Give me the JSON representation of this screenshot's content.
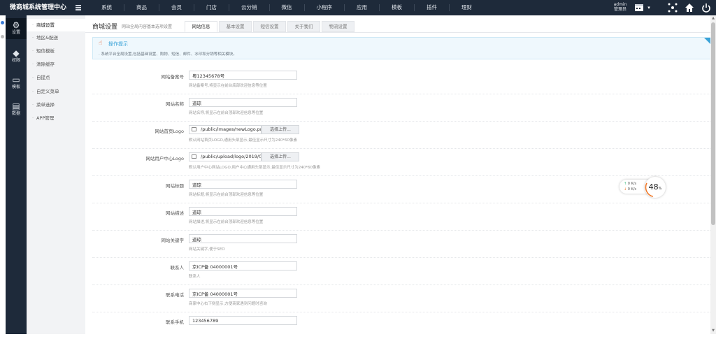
{
  "brand": {
    "title": "微商城系统管理中心"
  },
  "topnav": [
    "系统",
    "商品",
    "会员",
    "门店",
    "云分销",
    "微信",
    "小程序",
    "应用",
    "模板",
    "插件",
    "理财"
  ],
  "admin": {
    "name": "admin",
    "role": "管理员"
  },
  "sidebar": [
    {
      "label": "设置",
      "icon": "gear-icon"
    },
    {
      "label": "权限",
      "icon": "diamond-icon"
    },
    {
      "label": "模板",
      "icon": "monitor-icon"
    },
    {
      "label": "数据",
      "icon": "document-icon"
    }
  ],
  "subnav": [
    "商城设置",
    "地区&配送",
    "短信模板",
    "清除缓存",
    "自提点",
    "自定义菜单",
    "菜单选择",
    "APP管理"
  ],
  "page": {
    "title": "商城设置",
    "subtitle": "网站全局内容基本选项设置"
  },
  "tabs": [
    "网站信息",
    "基本设置",
    "短信设置",
    "关于我们",
    "物流设置"
  ],
  "tips": {
    "title": "操作提示",
    "text": "系统平台全局设置,包括基础设置、购物、短信、邮件、水印和分销等相关模块。"
  },
  "form": [
    {
      "label": "网站备案号",
      "value": "粤12345678号",
      "hint": "网站备案号,将显示在前台底部欢迎信息等位置"
    },
    {
      "label": "网站名称",
      "value": "道琼",
      "hint": "网站名称,将显示在前台顶部欢迎信息等位置"
    },
    {
      "label": "网站首页Logo",
      "value": "/public/images/newLogo.png",
      "button": "选择上传...",
      "hint": "默认网站首页LOGO,通用头部显示,最佳显示尺寸为240*60像素"
    },
    {
      "label": "网站用户中心Logo",
      "value": "/public/upload/logo/2019/0",
      "button": "选择上传...",
      "hint": "默认用户中心网站LOGO,用户中心通用头部显示,最佳显示尺寸为240*60像素"
    },
    {
      "label": "网站标题",
      "value": "道琼",
      "hint": "网站标题,将显示在前台顶部欢迎信息等位置"
    },
    {
      "label": "网站描述",
      "value": "道琼",
      "hint": "网站描述,将显示在前台顶部欢迎信息等位置"
    },
    {
      "label": "网站关键字",
      "value": "道琼",
      "hint": "网站关键字,便于SEO"
    },
    {
      "label": "联系人",
      "value": "京ICP备 04000001号",
      "hint": "联系人"
    },
    {
      "label": "联系电话",
      "value": "京ICP备 04000001号",
      "hint": "商家中心右下侧显示,方便商家遇到问题时咨询"
    },
    {
      "label": "联系手机",
      "value": "123456789",
      "hint": ""
    }
  ],
  "net": {
    "up": "0  K/s",
    "down": "0  K/s",
    "percent": "48",
    "percent_unit": "%"
  },
  "colors": {
    "topbar": "#1e2a3a",
    "accent": "#3ba3d8",
    "gauge": "#f07a2a"
  }
}
